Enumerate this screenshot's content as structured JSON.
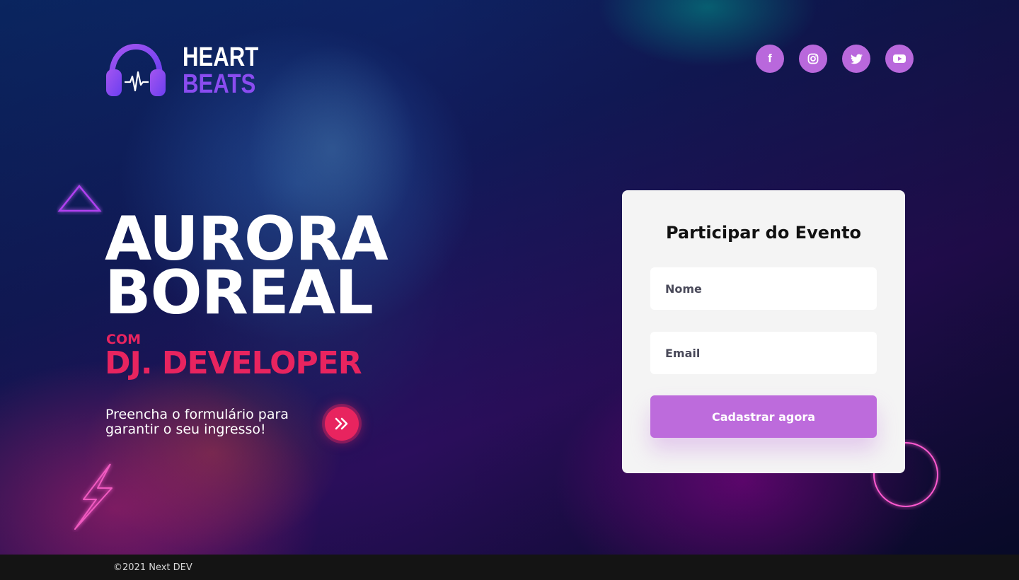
{
  "brand": {
    "line1": "HEART",
    "line2": "BEATS"
  },
  "social": [
    {
      "icon": "facebook-icon",
      "glyph": "f"
    },
    {
      "icon": "instagram-icon",
      "glyph": ""
    },
    {
      "icon": "twitter-icon",
      "glyph": ""
    },
    {
      "icon": "youtube-icon",
      "glyph": ""
    }
  ],
  "hero": {
    "title_line1": "AURORA",
    "title_line2": "BOREAL",
    "com": "COM",
    "dj": "DJ. DEVELOPER",
    "description": "Preencha o formulário para garantir o seu ingresso!"
  },
  "form": {
    "title": "Participar do Evento",
    "name_placeholder": "Nome",
    "email_placeholder": "Email",
    "submit_label": "Cadastrar agora"
  },
  "footer": {
    "copyright": "©2021 Next DEV"
  },
  "colors": {
    "accent_purple": "#bd6bdc",
    "accent_pink": "#e8245f",
    "logo_purple": "#8a4cf0"
  }
}
